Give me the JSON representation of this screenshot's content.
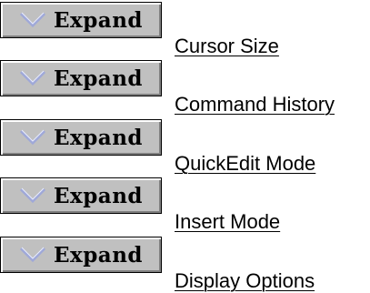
{
  "button_label": "Expand",
  "icon": "chevron-down-icon",
  "items": [
    {
      "label": "Cursor Size"
    },
    {
      "label": "Command History"
    },
    {
      "label": "QuickEdit Mode"
    },
    {
      "label": "Insert Mode"
    },
    {
      "label": "Display Options"
    }
  ]
}
